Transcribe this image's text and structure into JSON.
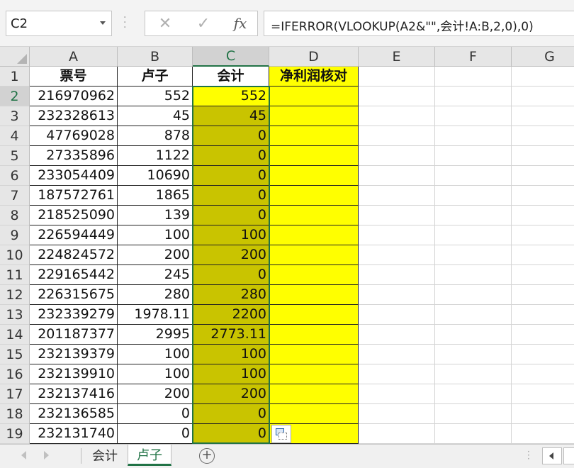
{
  "name_box": {
    "value": "C2"
  },
  "formula_bar": {
    "fx_label": "fx",
    "formula": "=IFERROR(VLOOKUP(A2&\"\",会计!A:B,2,0),0)"
  },
  "columns": [
    "A",
    "B",
    "C",
    "D",
    "E",
    "F",
    "G"
  ],
  "active_cell": "C2",
  "header_row": {
    "row": "1",
    "a": "票号",
    "b": "卢子",
    "c": "会计",
    "d": "净利润核对"
  },
  "rows": [
    {
      "row": "2",
      "a": "216970962",
      "b": "552",
      "c": "552"
    },
    {
      "row": "3",
      "a": "232328613",
      "b": "45",
      "c": "45"
    },
    {
      "row": "4",
      "a": "47769028",
      "b": "878",
      "c": "0"
    },
    {
      "row": "5",
      "a": "27335896",
      "b": "1122",
      "c": "0"
    },
    {
      "row": "6",
      "a": "233054409",
      "b": "10690",
      "c": "0"
    },
    {
      "row": "7",
      "a": "187572761",
      "b": "1865",
      "c": "0"
    },
    {
      "row": "8",
      "a": "218525090",
      "b": "139",
      "c": "0"
    },
    {
      "row": "9",
      "a": "226594449",
      "b": "100",
      "c": "100"
    },
    {
      "row": "10",
      "a": "224824572",
      "b": "200",
      "c": "200"
    },
    {
      "row": "11",
      "a": "229165442",
      "b": "245",
      "c": "0"
    },
    {
      "row": "12",
      "a": "226315675",
      "b": "280",
      "c": "280"
    },
    {
      "row": "13",
      "a": "232339279",
      "b": "1978.11",
      "c": "2200"
    },
    {
      "row": "14",
      "a": "201187377",
      "b": "2995",
      "c": "2773.11"
    },
    {
      "row": "15",
      "a": "232139379",
      "b": "100",
      "c": "100"
    },
    {
      "row": "16",
      "a": "232139910",
      "b": "100",
      "c": "100"
    },
    {
      "row": "17",
      "a": "232137416",
      "b": "200",
      "c": "200"
    },
    {
      "row": "18",
      "a": "232136585",
      "b": "0",
      "c": "0"
    },
    {
      "row": "19",
      "a": "232131740",
      "b": "0",
      "c": "0"
    }
  ],
  "sheet_tabs": [
    {
      "label": "会计",
      "active": false
    },
    {
      "label": "卢子",
      "active": true
    }
  ],
  "add_sheet_label": "+",
  "colors": {
    "excel_green": "#217346",
    "highlight_yellow": "#ffff00",
    "selection_olive": "#c9c400"
  },
  "icons": [
    "cancel-icon",
    "enter-check-icon",
    "fx-icon",
    "dropdown-arrow-icon",
    "paste-options-icon",
    "add-sheet-icon",
    "scroll-left-icon"
  ]
}
